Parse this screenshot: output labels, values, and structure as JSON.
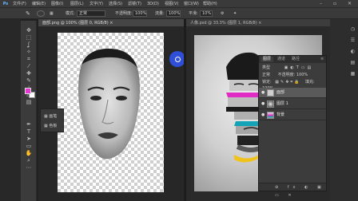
{
  "app": {
    "logo": "Ps"
  },
  "menubar": {
    "items": [
      "文件(F)",
      "编辑(E)",
      "图像(I)",
      "图层(L)",
      "文字(Y)",
      "选择(S)",
      "滤镜(T)",
      "3D(D)",
      "视图(V)",
      "窗口(W)",
      "帮助(H)"
    ],
    "window_controls": "– ▫ ✕"
  },
  "options": {
    "mode_label": "正常",
    "opacity_label": "不透明度:",
    "opacity_value": "100%",
    "flow_label": "流量:",
    "flow_value": "100%",
    "smooth_label": "平滑:",
    "smooth_value": "10%"
  },
  "document_tabs": {
    "tab1": "面部.png @ 100% (图层 0, RGB/8) ×",
    "tab2": "人像.psd @ 33.3% (图层 1, RGB/8) ×"
  },
  "collapsed_panel": {
    "items": [
      {
        "icon": "brush-icon",
        "label": "画笔"
      },
      {
        "icon": "swatch-icon",
        "label": "色板"
      }
    ]
  },
  "colors": {
    "foreground": "#e637d0",
    "background": "#ffffff",
    "cursor": "#2f4fd8"
  },
  "layers_panel": {
    "tabs": [
      "图层",
      "通道",
      "路径"
    ],
    "filter_label": "类型",
    "blend_mode": "正常",
    "opacity_label": "不透明度:",
    "opacity_value": "100%",
    "lock_label": "锁定:",
    "fill_label": "填充:",
    "fill_value": "100%",
    "layers": [
      {
        "name": "面部",
        "visible": true,
        "selected": true
      },
      {
        "name": "图层 1",
        "visible": true,
        "selected": false
      },
      {
        "name": "背景",
        "visible": true,
        "selected": false
      }
    ],
    "footer_icons": "⊕ fx ◐ ▣ ▭ ✕"
  }
}
